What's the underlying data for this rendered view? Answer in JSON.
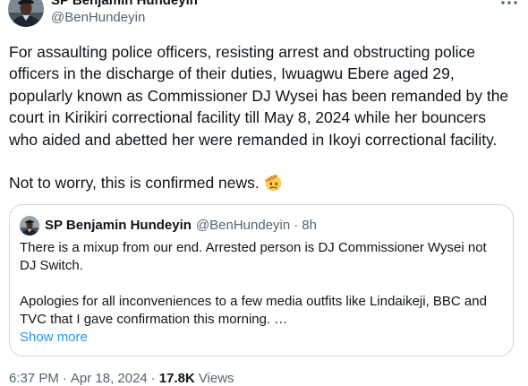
{
  "author": {
    "name": "SP Benjamin Hundeyin",
    "handle": "@BenHundeyin"
  },
  "icons": {
    "more": "more-horizontal-icon",
    "closing_emoji": "saluting-face-icon",
    "author_avatar": "avatar-photo",
    "quoted_avatar": "avatar-photo"
  },
  "tweet": {
    "paragraphs": [
      [
        "For assaulting police officers, resisting arrest and obstructing police",
        "officers in the discharge of their duties, Iwuagwu Ebere aged 29,",
        "popularly known as Commissioner DJ Wysei has been remanded by the",
        "court in Kirikiri correctional facility till May 8, 2024 while her bouncers",
        "who aided and abetted her were remanded in Ikoyi correctional facility."
      ],
      [
        "Not to worry, this is confirmed news."
      ]
    ]
  },
  "quoted_tweet": {
    "author_name": "SP Benjamin Hundeyin",
    "author_handle": "@BenHundeyin",
    "separator": "·",
    "time": "8h",
    "paragraphs": [
      [
        "There is a mixup from our end. Arrested person is DJ Commissioner Wysei not",
        "DJ Switch."
      ],
      [
        "Apologies for all inconveniences to a few media outfits like Lindaikeji, BBC and",
        "TVC that I gave confirmation this morning. …"
      ]
    ],
    "show_more": "Show more"
  },
  "footer": {
    "time": "6:37 PM",
    "separator": "·",
    "date": "Apr 18, 2024",
    "views_count": "17.8K",
    "views_label": "Views"
  },
  "colors": {
    "text_primary": "#0f1419",
    "text_secondary": "#536471",
    "accent": "#1d9bf0",
    "border": "#cfd9de",
    "background": "#ffffff"
  }
}
